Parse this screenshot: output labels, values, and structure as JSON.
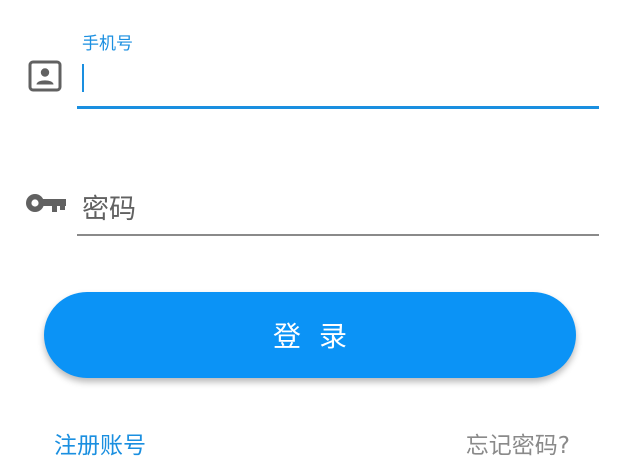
{
  "phone_field": {
    "label": "手机号",
    "value": "",
    "icon": "contact-card-icon"
  },
  "password_field": {
    "placeholder": "密码",
    "icon": "key-icon"
  },
  "login_button": {
    "label": "登录"
  },
  "links": {
    "register": "注册账号",
    "forgot_password": "忘记密码?"
  },
  "colors": {
    "accent": "#1a8fe0",
    "button": "#0b93f6",
    "icon": "#616161",
    "muted_text": "#8a8a8a"
  }
}
